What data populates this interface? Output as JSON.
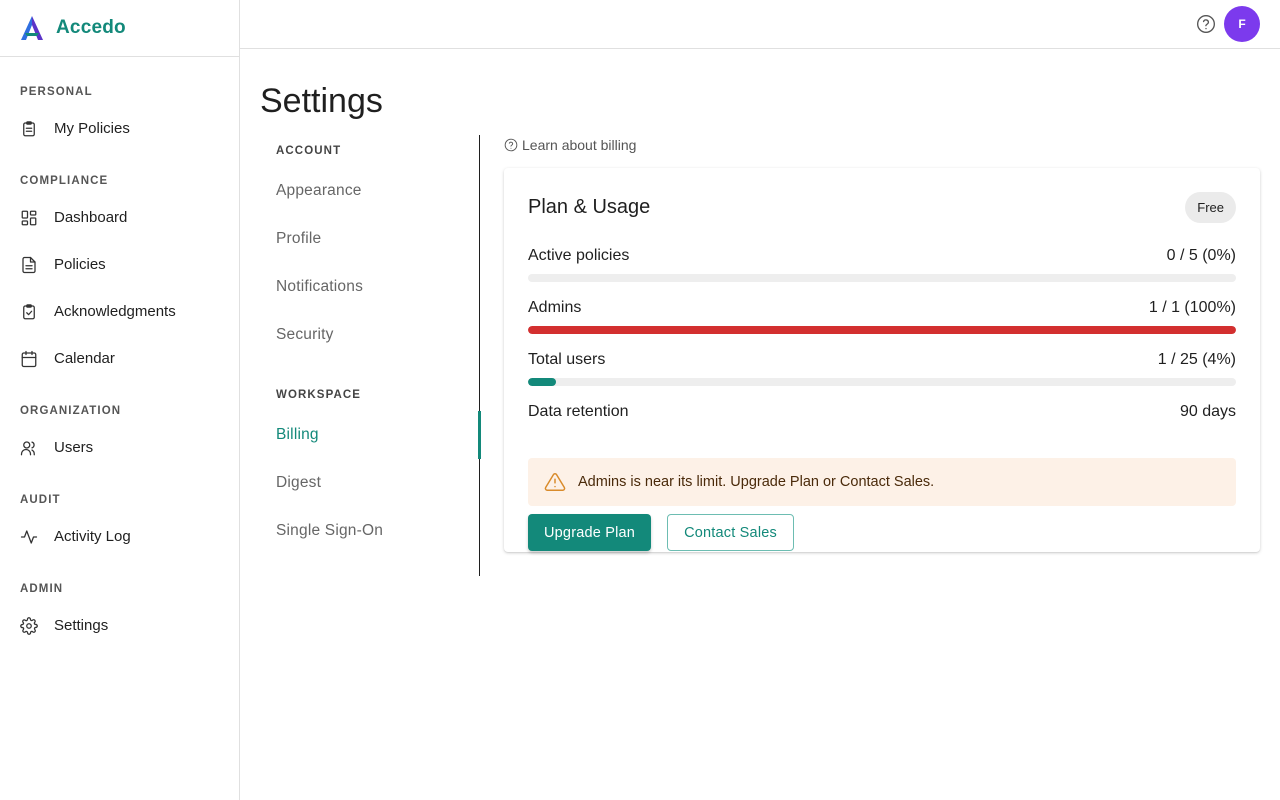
{
  "brand": {
    "name": "Accedo"
  },
  "sidebar": {
    "sections": [
      {
        "title": "PERSONAL",
        "items": [
          {
            "label": "My Policies",
            "icon": "clipboard-icon"
          }
        ]
      },
      {
        "title": "COMPLIANCE",
        "items": [
          {
            "label": "Dashboard",
            "icon": "dashboard-icon"
          },
          {
            "label": "Policies",
            "icon": "document-icon"
          },
          {
            "label": "Acknowledgments",
            "icon": "clipboard-check-icon"
          },
          {
            "label": "Calendar",
            "icon": "calendar-icon"
          }
        ]
      },
      {
        "title": "ORGANIZATION",
        "items": [
          {
            "label": "Users",
            "icon": "users-icon"
          }
        ]
      },
      {
        "title": "AUDIT",
        "items": [
          {
            "label": "Activity Log",
            "icon": "activity-icon"
          }
        ]
      },
      {
        "title": "ADMIN",
        "items": [
          {
            "label": "Settings",
            "icon": "gear-icon"
          }
        ]
      }
    ]
  },
  "topbar": {
    "avatar_initial": "F"
  },
  "page": {
    "title": "Settings"
  },
  "settings_nav": {
    "account_title": "ACCOUNT",
    "account_items": [
      "Appearance",
      "Profile",
      "Notifications",
      "Security"
    ],
    "workspace_title": "WORKSPACE",
    "workspace_items": [
      "Billing",
      "Digest",
      "Single Sign-On"
    ],
    "active": "Billing"
  },
  "billing": {
    "learn_link": "Learn about billing",
    "card_title": "Plan & Usage",
    "plan": "Free",
    "metrics": [
      {
        "label": "Active policies",
        "value": "0 / 5 (0%)",
        "fraction": 0.0,
        "color": "#13897a"
      },
      {
        "label": "Admins",
        "value": "1 / 1 (100%)",
        "fraction": 1.0,
        "color": "#d32f2f"
      },
      {
        "label": "Total users",
        "value": "1 / 25 (4%)",
        "fraction": 0.04,
        "color": "#13897a"
      }
    ],
    "retention": {
      "label": "Data retention",
      "value": "90 days"
    },
    "alert": "Admins is near its limit. Upgrade Plan or Contact Sales.",
    "upgrade_label": "Upgrade Plan",
    "contact_label": "Contact Sales"
  },
  "colors": {
    "accent": "#13897a",
    "danger": "#d32f2f",
    "avatar": "#7c3aed",
    "alert_bg": "#fdf1e7"
  }
}
